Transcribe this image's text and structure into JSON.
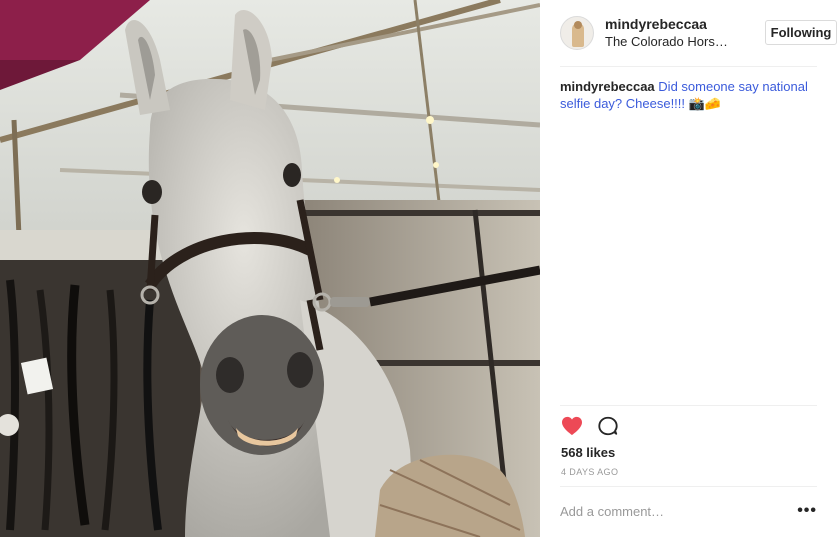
{
  "post": {
    "username": "mindyrebeccaa",
    "location": "The Colorado Hors…",
    "follow_button": "Following",
    "caption_user": "mindyrebeccaa",
    "caption_text": "Did someone say national selfie day? Cheese!!!! 📸🧀",
    "likes": "568 likes",
    "time": "4 DAYS AGO",
    "comment_placeholder": "Add a comment…",
    "more_label": "•••"
  },
  "icons": {
    "like": "heart-icon",
    "comment": "comment-bubble-icon"
  },
  "colors": {
    "heart": "#ed4956",
    "caption_link": "#3b5bdb"
  }
}
